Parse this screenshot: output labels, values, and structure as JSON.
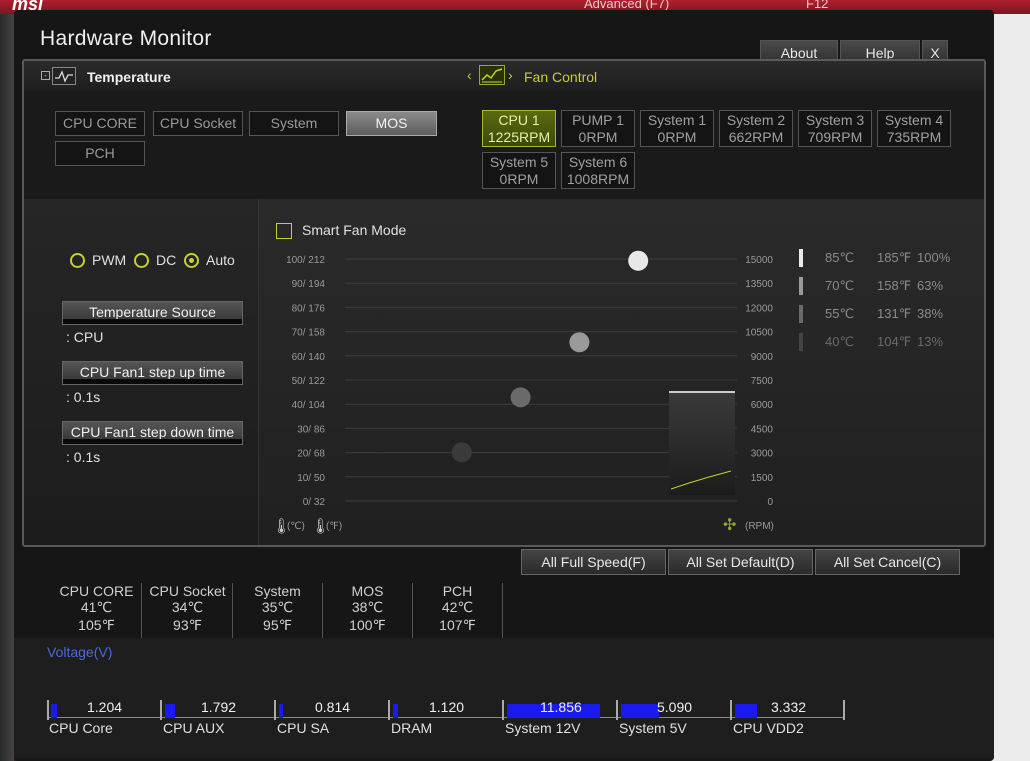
{
  "window": {
    "title": "Hardware Monitor",
    "buttons": {
      "about": "About",
      "help": "Help",
      "close": "X"
    }
  },
  "background": {
    "brand": "msi",
    "top_text_1": "Advanced (F7)",
    "top_text_2": "F12"
  },
  "temperature_panel": {
    "title": "Temperature",
    "sensors": [
      "CPU CORE",
      "CPU Socket",
      "System",
      "MOS",
      "PCH"
    ],
    "active_sensor": "MOS"
  },
  "fan_panel": {
    "title": "Fan Control",
    "fans": [
      {
        "name": "CPU 1",
        "rpm": "1225RPM"
      },
      {
        "name": "PUMP 1",
        "rpm": "0RPM"
      },
      {
        "name": "System 1",
        "rpm": "0RPM"
      },
      {
        "name": "System 2",
        "rpm": "662RPM"
      },
      {
        "name": "System 3",
        "rpm": "709RPM"
      },
      {
        "name": "System 4",
        "rpm": "735RPM"
      },
      {
        "name": "System 5",
        "rpm": "0RPM"
      },
      {
        "name": "System 6",
        "rpm": "1008RPM"
      }
    ],
    "active_fan": "CPU 1"
  },
  "fan_settings": {
    "modes": [
      "PWM",
      "DC",
      "Auto"
    ],
    "selected_mode": "Auto",
    "temperature_source_label": "Temperature Source",
    "temperature_source_value": ": CPU",
    "step_up_label": "CPU Fan1 step up time",
    "step_up_value": ": 0.1s",
    "step_down_label": "CPU Fan1 step down time",
    "step_down_value": ": 0.1s"
  },
  "smart_fan": {
    "label": "Smart Fan Mode",
    "checked": false,
    "left_ticks": [
      "100/ 212",
      "90/ 194",
      "80/ 176",
      "70/ 158",
      "60/ 140",
      "50/ 122",
      "40/ 104",
      "30/  86",
      "20/  68",
      "10/  50",
      "0/  32"
    ],
    "right_ticks": [
      "15000",
      "13500",
      "12000",
      "10500",
      "9000",
      "7500",
      "6000",
      "4500",
      "3000",
      "1500",
      "0"
    ],
    "unit_c": "(℃)",
    "unit_f": "(℉)",
    "unit_rpm": "(RPM)",
    "legend": [
      {
        "c": "85℃",
        "f": "185℉",
        "pct": "100%"
      },
      {
        "c": "70℃",
        "f": "158℉",
        "pct": "63%"
      },
      {
        "c": "55℃",
        "f": "131℉",
        "pct": "38%"
      },
      {
        "c": "40℃",
        "f": "104℉",
        "pct": "13%"
      }
    ]
  },
  "chart_data": {
    "type": "scatter",
    "title": "",
    "xlabel": "",
    "ylabel": "",
    "series": [
      {
        "points": [
          {
            "temp_c": 40,
            "rpm_pct": 13
          },
          {
            "temp_c": 55,
            "rpm_pct": 38
          },
          {
            "temp_c": 70,
            "rpm_pct": 63
          },
          {
            "temp_c": 85,
            "rpm_pct": 100
          }
        ]
      }
    ],
    "ylim": [
      0,
      100
    ],
    "rpm_range": [
      0,
      15000
    ]
  },
  "actions": {
    "full_speed": "All Full Speed(F)",
    "set_default": "All Set Default(D)",
    "set_cancel": "All Set Cancel(C)"
  },
  "temperatures": [
    {
      "name": "CPU CORE",
      "c": "41℃",
      "f": "105℉"
    },
    {
      "name": "CPU Socket",
      "c": "34℃",
      "f": "93℉"
    },
    {
      "name": "System",
      "c": "35℃",
      "f": "95℉"
    },
    {
      "name": "MOS",
      "c": "38℃",
      "f": "100℉"
    },
    {
      "name": "PCH",
      "c": "42℃",
      "f": "107℉"
    }
  ],
  "voltage": {
    "title": "Voltage(V)",
    "items": [
      {
        "name": "CPU Core",
        "value": "1.204"
      },
      {
        "name": "CPU AUX",
        "value": "1.792"
      },
      {
        "name": "CPU SA",
        "value": "0.814"
      },
      {
        "name": "DRAM",
        "value": "1.120"
      },
      {
        "name": "System 12V",
        "value": "11.856"
      },
      {
        "name": "System 5V",
        "value": "5.090"
      },
      {
        "name": "CPU VDD2",
        "value": "3.332"
      }
    ]
  },
  "colors": {
    "accent": "#c8d030",
    "voltage_bar": "#1a1af0",
    "voltage_title": "#4a6ad8"
  }
}
